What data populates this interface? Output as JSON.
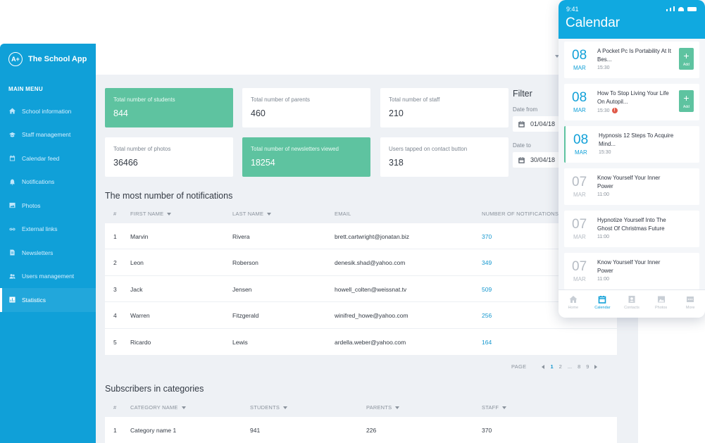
{
  "app": {
    "name": "The School App",
    "logo": "A+"
  },
  "sidebar": {
    "title": "MAIN MENU",
    "items": [
      {
        "label": "School information",
        "icon": "home-icon"
      },
      {
        "label": "Staff management",
        "icon": "graduation-cap-icon"
      },
      {
        "label": "Calendar feed",
        "icon": "calendar-icon"
      },
      {
        "label": "Notifications",
        "icon": "bell-icon"
      },
      {
        "label": "Photos",
        "icon": "image-icon"
      },
      {
        "label": "External links",
        "icon": "link-icon"
      },
      {
        "label": "Newsletters",
        "icon": "document-icon"
      },
      {
        "label": "Users management",
        "icon": "users-icon"
      },
      {
        "label": "Statistics",
        "icon": "bar-chart-icon",
        "active": true
      }
    ]
  },
  "cards": [
    {
      "label": "Total number of students",
      "value": "844",
      "highlight": true
    },
    {
      "label": "Total number of parents",
      "value": "460"
    },
    {
      "label": "Total number of staff",
      "value": "210"
    },
    {
      "label": "Total number of photos",
      "value": "36466"
    },
    {
      "label": "Total number of newsletters viewed",
      "value": "18254",
      "highlight": true
    },
    {
      "label": "Users tapped on contact button",
      "value": "318"
    }
  ],
  "filter": {
    "title": "Filter",
    "from_label": "Date from",
    "from_value": "01/04/18",
    "to_label": "Date to",
    "to_value": "30/04/18"
  },
  "notifications": {
    "title": "The most number of notifications",
    "headers": [
      "#",
      "FIRST NAME",
      "LAST NAME",
      "EMAIL",
      "NUMBER OF NOTIFICATIONS"
    ],
    "rows": [
      [
        "1",
        "Marvin",
        "Rivera",
        "brett.cartwright@jonatan.biz",
        "370"
      ],
      [
        "2",
        "Leon",
        "Roberson",
        "denesik.shad@yahoo.com",
        "349"
      ],
      [
        "3",
        "Jack",
        "Jensen",
        "howell_colten@weissnat.tv",
        "509"
      ],
      [
        "4",
        "Warren",
        "Fitzgerald",
        "winifred_howe@yahoo.com",
        "256"
      ],
      [
        "5",
        "Ricardo",
        "Lewis",
        "ardella.weber@yahoo.com",
        "164"
      ]
    ]
  },
  "pagination": {
    "label": "PAGE",
    "pages": [
      "1",
      "2",
      "...",
      "8",
      "9"
    ],
    "current": "1"
  },
  "subscribers": {
    "title": "Subscribers in categories",
    "headers": [
      "#",
      "CATEGORY NAME",
      "STUDENTS",
      "PARENTS",
      "STAFF"
    ],
    "rows": [
      [
        "1",
        "Category name 1",
        "941",
        "226",
        "370"
      ]
    ]
  },
  "phone": {
    "time": "9:41",
    "title": "Calendar",
    "add_label": "Add",
    "events": [
      {
        "day": "08",
        "month": "MAR",
        "title": "A Pocket Pc Is Portability At It Bes...",
        "time": "15:30",
        "add": true
      },
      {
        "day": "08",
        "month": "MAR",
        "title": "How To Stop Living Your Life On Autopil...",
        "time": "15:30",
        "add": true,
        "warning": true
      },
      {
        "day": "08",
        "month": "MAR",
        "title": "Hypnosis 12 Steps To Acquire Mind...",
        "time": "15:30",
        "highlight": true
      },
      {
        "day": "07",
        "month": "MAR",
        "title": "Know Yourself Your Inner Power",
        "time": "11:00",
        "past": true
      },
      {
        "day": "07",
        "month": "MAR",
        "title": "Hypnotize Yourself Into The Ghost Of Christmas Future",
        "time": "11:00",
        "past": true
      },
      {
        "day": "07",
        "month": "MAR",
        "title": "Know Yourself Your Inner Power",
        "time": "11:00",
        "past": true
      }
    ],
    "tabs": [
      {
        "label": "Home",
        "icon": "home-icon"
      },
      {
        "label": "Calendar",
        "icon": "calendar-icon",
        "active": true
      },
      {
        "label": "Contacts",
        "icon": "contact-card-icon"
      },
      {
        "label": "Photos",
        "icon": "image-icon"
      },
      {
        "label": "More",
        "icon": "more-icon"
      }
    ]
  },
  "colors": {
    "primary": "#10a0d8",
    "accent": "#5ec3a0",
    "background": "#eef1f5"
  }
}
